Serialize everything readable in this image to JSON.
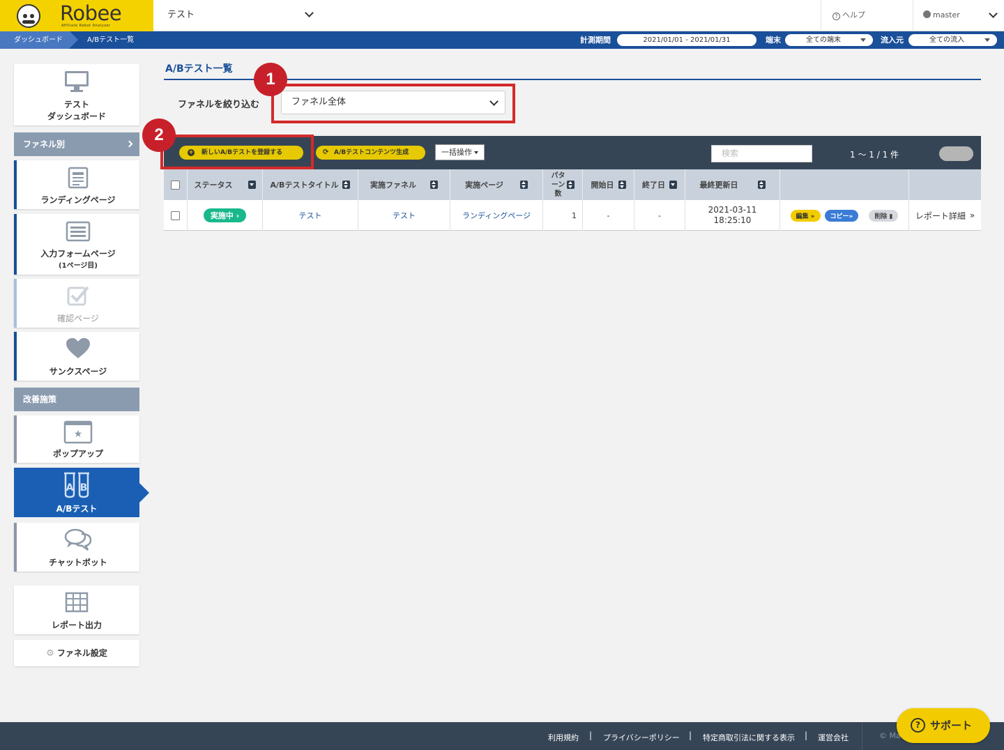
{
  "header": {
    "logo_text": "Robee",
    "logo_sub": "Affiliate Robot Analyzer",
    "funnel_select": "テスト",
    "help_label": "ヘルプ",
    "user_label": "master"
  },
  "breadcrumb": [
    "ダッシュボード",
    "A/Bテスト一覧"
  ],
  "filters": {
    "period_label": "計測期間",
    "period_value": "2021/01/01 - 2021/01/31",
    "device_label": "端末",
    "device_value": "全ての端末",
    "source_label": "流入元",
    "source_value": "全ての流入"
  },
  "sidebar": {
    "dashboard": [
      "テスト",
      "ダッシュボード"
    ],
    "funnel_header": "ファネル別",
    "landing": "ランディングページ",
    "input_form": [
      "入力フォームページ",
      "(1ページ目)"
    ],
    "confirm": "確認ページ",
    "thanks": "サンクスページ",
    "improve_header": "改善施策",
    "popup": "ポップアップ",
    "abtest": "A/Bテスト",
    "chatbot": "チャットボット",
    "report": "レポート出力",
    "funnel_settings": "ファネル設定"
  },
  "main": {
    "title": "A/Bテスト一覧",
    "filter_label": "ファネルを絞り込む",
    "filter_value": "ファネル全体",
    "badge1": "1",
    "badge2": "2",
    "btn_new": "新しいA/Bテストを登録する",
    "btn_generate": "A/Bテストコンテンツ生成",
    "btn_bulk": "一括操作",
    "search_placeholder": "検索",
    "count": "1 〜 1 / 1 件"
  },
  "table": {
    "headers": {
      "status": "ステータス",
      "title": "A/Bテストタイトル",
      "funnel": "実施ファネル",
      "page": "実施ページ",
      "patterns": [
        "パタ",
        "ーン",
        "数"
      ],
      "start": "開始日",
      "end": "終了日",
      "updated": "最終更新日"
    },
    "rows": [
      {
        "status": "実施中",
        "title": "テスト",
        "funnel": "テスト",
        "page": "ランディングページ",
        "patterns": "1",
        "start": "-",
        "end": "-",
        "updated_date": "2021-03-11",
        "updated_time": "18:25:10",
        "edit": "編集",
        "copy": "コピー",
        "delete": "削除",
        "report": "レポート詳細"
      }
    ]
  },
  "footer": {
    "links": [
      "利用規約",
      "プライバシーポリシー",
      "特定商取引法に関する表示",
      "運営会社"
    ],
    "copyright": "© Ma",
    "support": "サポート"
  },
  "colors": {
    "brand_yellow": "#f4d200",
    "brand_blue": "#1a4f99",
    "active_blue": "#1a5fb4",
    "status_green": "#19b88c",
    "highlight_red": "#d32a2a"
  }
}
